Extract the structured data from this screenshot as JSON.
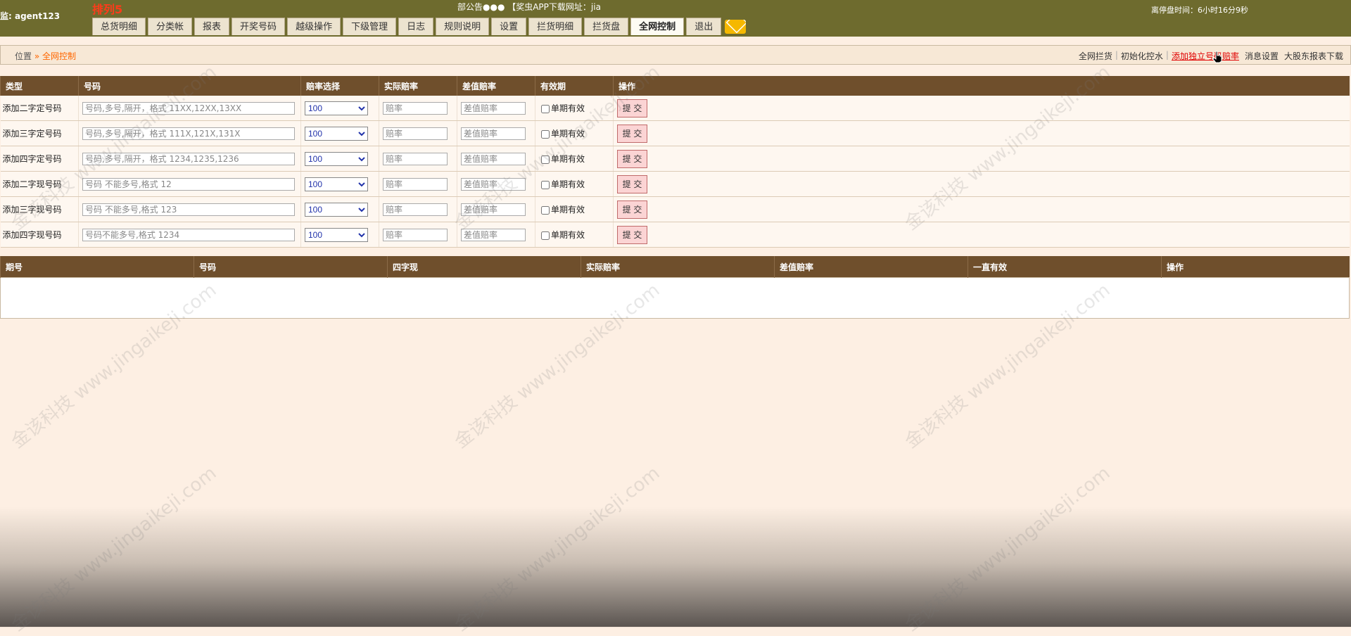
{
  "header": {
    "user": "监: agent123",
    "logo": "排列5",
    "notice": "部公告●●● 【奖虫APP下载网址：jia",
    "timer": "离停盘时间：6小时16分9秒",
    "tabs": [
      "总货明细",
      "分类帐",
      "报表",
      "开奖号码",
      "越级操作",
      "下级管理",
      "日志",
      "规则说明",
      "设置",
      "拦货明细",
      "拦货盘",
      "全网控制",
      "退出"
    ],
    "active_tab": "全网控制",
    "mail_icon": "envelope-icon"
  },
  "breadcrumb": {
    "label": "位置",
    "sep": "»",
    "current": "全网控制"
  },
  "toplinks": [
    "全网拦货",
    "初始化控水",
    "添加独立号码赔率",
    "消息设置",
    "大股东报表下载"
  ],
  "form_table": {
    "headers": [
      "类型",
      "号码",
      "赔率选择",
      "实际赔率",
      "差值赔率",
      "有效期",
      "操作"
    ],
    "rows": [
      {
        "type": "添加二字定号码",
        "placeholder": "号码,多号,隔开，格式 11XX,12XX,13XX",
        "rate": "100",
        "actual_ph": "赔率",
        "diff_ph": "差值赔率",
        "valid": "单期有效",
        "submit": "提 交"
      },
      {
        "type": "添加三字定号码",
        "placeholder": "号码,多号,隔开，格式 111X,121X,131X",
        "rate": "100",
        "actual_ph": "赔率",
        "diff_ph": "差值赔率",
        "valid": "单期有效",
        "submit": "提 交"
      },
      {
        "type": "添加四字定号码",
        "placeholder": "号码,多号,隔开，格式 1234,1235,1236",
        "rate": "100",
        "actual_ph": "赔率",
        "diff_ph": "差值赔率",
        "valid": "单期有效",
        "submit": "提 交"
      },
      {
        "type": "添加二字现号码",
        "placeholder": "号码 不能多号,格式 12",
        "rate": "100",
        "actual_ph": "赔率",
        "diff_ph": "差值赔率",
        "valid": "单期有效",
        "submit": "提 交"
      },
      {
        "type": "添加三字现号码",
        "placeholder": "号码 不能多号,格式 123",
        "rate": "100",
        "actual_ph": "赔率",
        "diff_ph": "差值赔率",
        "valid": "单期有效",
        "submit": "提 交"
      },
      {
        "type": "添加四字现号码",
        "placeholder": "号码不能多号,格式 1234",
        "rate": "100",
        "actual_ph": "赔率",
        "diff_ph": "差值赔率",
        "valid": "单期有效",
        "submit": "提 交"
      }
    ]
  },
  "list_table": {
    "headers": [
      "期号",
      "号码",
      "四字现",
      "实际赔率",
      "差值赔率",
      "一直有效",
      "操作"
    ]
  },
  "watermark": "金该科技 www.jingaikeji.com"
}
